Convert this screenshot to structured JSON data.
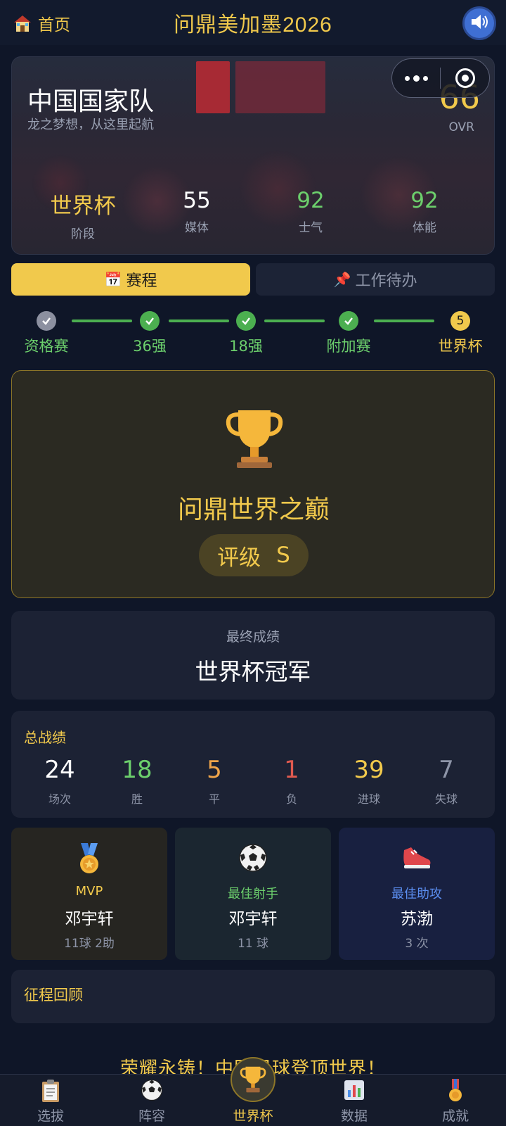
{
  "header": {
    "home_label": "首页",
    "title": "问鼎美加墨2026"
  },
  "team": {
    "name": "中国国家队",
    "slogan": "龙之梦想，从这里起航",
    "ovr_value": "66",
    "ovr_label": "OVR",
    "stats": [
      {
        "value": "世界杯",
        "label": "阶段",
        "color": "#f1c94c"
      },
      {
        "value": "55",
        "label": "媒体",
        "color": "#ffffff"
      },
      {
        "value": "92",
        "label": "士气",
        "color": "#6ccf6c"
      },
      {
        "value": "92",
        "label": "体能",
        "color": "#6ccf6c"
      }
    ]
  },
  "tabs": {
    "schedule_icon": "📅",
    "schedule": "赛程",
    "todo_icon": "📌",
    "todo": "工作待办"
  },
  "progress": {
    "steps": [
      "资格赛",
      "36强",
      "18强",
      "附加赛",
      "世界杯"
    ],
    "current_number": "5"
  },
  "achievement": {
    "title": "问鼎世界之巅",
    "grade_label": "评级",
    "grade_value": "S"
  },
  "final_result": {
    "label": "最终成绩",
    "value": "世界杯冠军"
  },
  "record": {
    "title": "总战绩",
    "items": [
      {
        "value": "24",
        "label": "场次",
        "color": "#ffffff"
      },
      {
        "value": "18",
        "label": "胜",
        "color": "#6ccf6c"
      },
      {
        "value": "5",
        "label": "平",
        "color": "#f0a54a"
      },
      {
        "value": "1",
        "label": "负",
        "color": "#e05a4f"
      },
      {
        "value": "39",
        "label": "进球",
        "color": "#f1c94c"
      },
      {
        "value": "7",
        "label": "失球",
        "color": "#8e95a8"
      }
    ]
  },
  "awards": [
    {
      "title": "MVP",
      "name": "邓宇轩",
      "detail": "11球 2助",
      "title_color": "#f1c94c",
      "icon": "medal-icon"
    },
    {
      "title": "最佳射手",
      "name": "邓宇轩",
      "detail": "11 球",
      "title_color": "#6ccf6c",
      "icon": "soccer-ball-icon"
    },
    {
      "title": "最佳助攻",
      "name": "苏渤",
      "detail": "3 次",
      "title_color": "#5b8ef0",
      "icon": "shoe-icon"
    }
  ],
  "journey": {
    "title": "征程回顾"
  },
  "banner": "荣耀永铸！中国足球登顶世界！",
  "bottom_nav": [
    {
      "label": "选拔",
      "icon": "clipboard-icon"
    },
    {
      "label": "阵容",
      "icon": "soccer-ball-icon"
    },
    {
      "label": "世界杯",
      "icon": "trophy-icon"
    },
    {
      "label": "数据",
      "icon": "bar-chart-icon"
    },
    {
      "label": "成就",
      "icon": "medal-icon"
    }
  ],
  "colors": {
    "accent": "#f1c94c",
    "background": "#0f1628",
    "card": "#1c2234",
    "success": "#4caf50"
  }
}
